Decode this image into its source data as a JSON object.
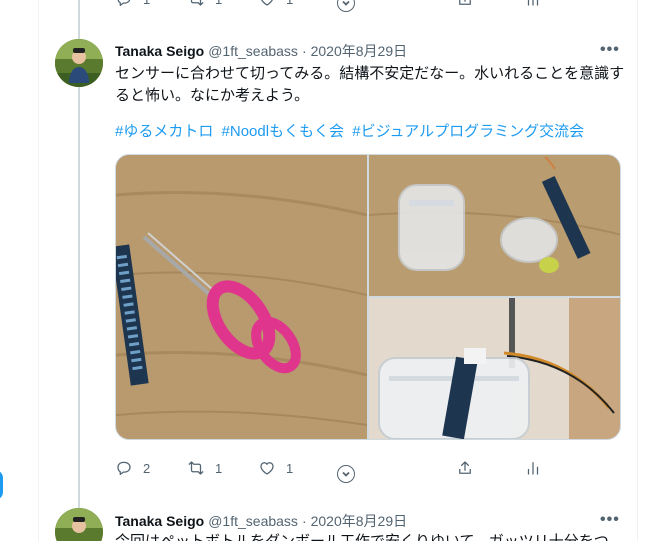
{
  "tweets": [
    {
      "name": "Tanaka Seigo",
      "handle": "@1ft_seabass",
      "dot": "·",
      "date": "2020年8月29日",
      "more": "•••",
      "text": "センサーに合わせて切ってみる。結構不安定だなー。水いれることを意識すると怖い。なにか考えよう。",
      "hashtags": [
        "#ゆるメカトロ",
        "#Noodlもくもく会",
        "#ビジュアルプログラミング交流会"
      ],
      "actions": {
        "reply": "2",
        "retweet": "1",
        "like": "1"
      }
    },
    {
      "name": "Tanaka Seigo",
      "handle": "@1ft_seabass",
      "dot": "·",
      "date": "2020年8月29日",
      "more": "•••",
      "text": "今回はペットボトルをダンボール工作で安くりゆいて、ガッツリ十分をつ"
    }
  ],
  "top_actions": {
    "reply": "1",
    "retweet": "1",
    "like": "1"
  },
  "icons": [
    "reply-icon",
    "retweet-icon",
    "like-icon",
    "share-icon",
    "analytics-icon",
    "show-thread-icon"
  ],
  "colors": {
    "link": "#1d9bf0",
    "muted": "#536471",
    "text": "#0f1419",
    "border": "#cfd9de"
  }
}
